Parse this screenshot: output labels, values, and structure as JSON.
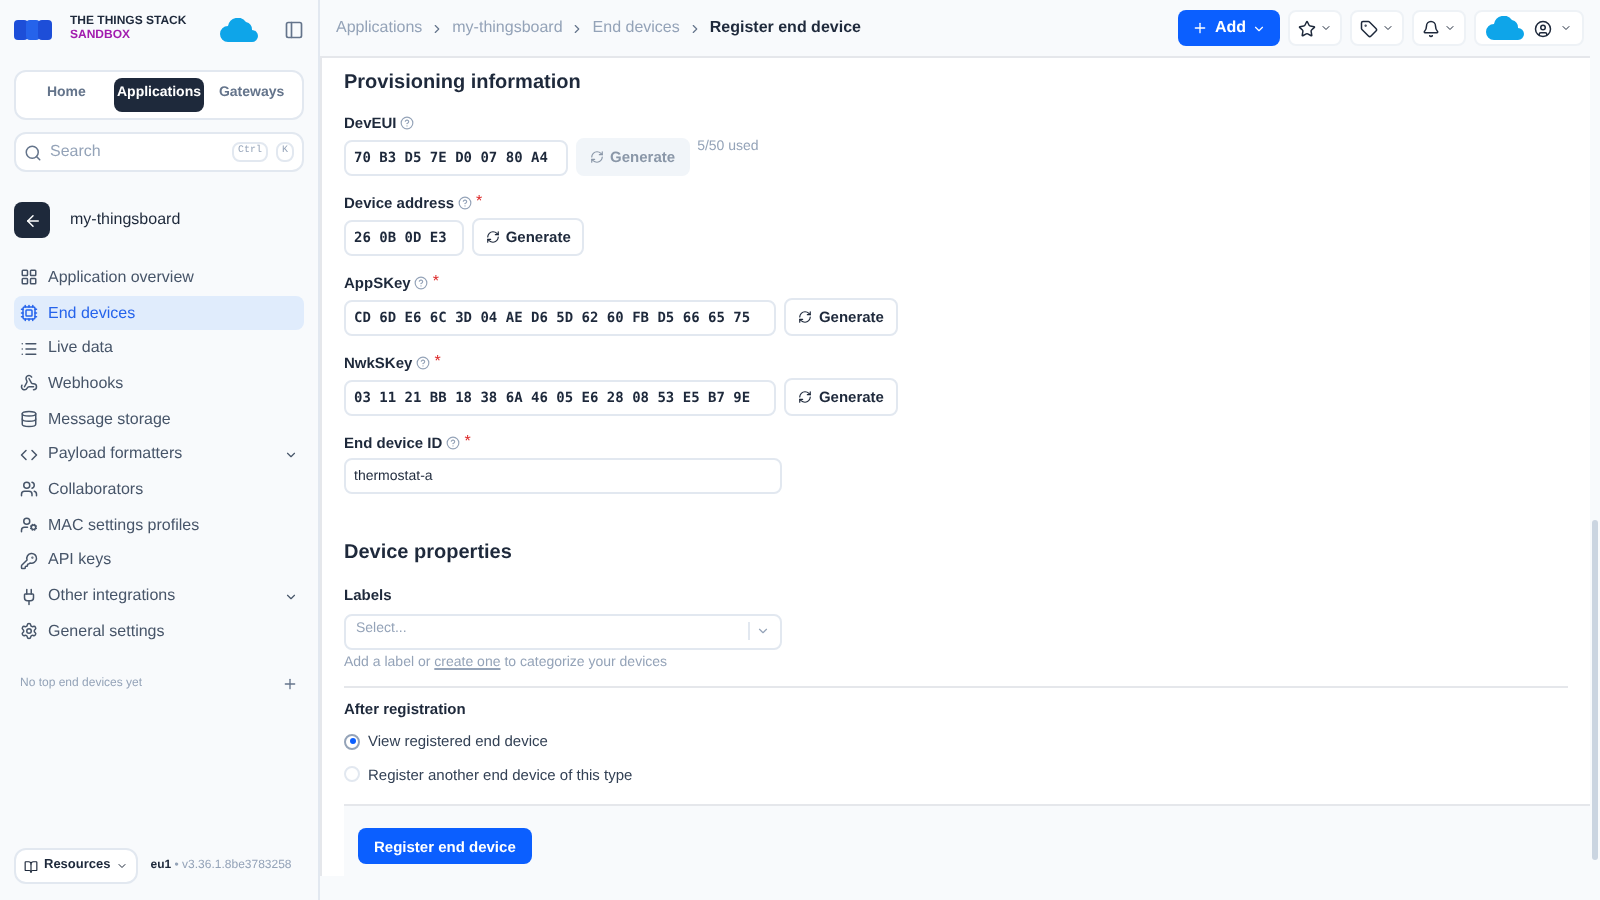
{
  "sidebar": {
    "logo": {
      "line1": "THE THINGS STACK",
      "line2": "SANDBOX"
    },
    "tabs": [
      {
        "label": "Home",
        "selected": false
      },
      {
        "label": "Applications",
        "selected": true
      },
      {
        "label": "Gateways",
        "selected": false
      }
    ],
    "search": {
      "placeholder": "Search",
      "keys": [
        "Ctrl",
        "K"
      ]
    },
    "application": "my-thingsboard",
    "items": [
      {
        "kind": "overview",
        "label": "Application overview",
        "selected": false,
        "expandable": false
      },
      {
        "kind": "devices",
        "label": "End devices",
        "selected": true,
        "expandable": false
      },
      {
        "kind": "live",
        "label": "Live data",
        "selected": false,
        "expandable": false
      },
      {
        "kind": "webhooks",
        "label": "Webhooks",
        "selected": false,
        "expandable": false
      },
      {
        "kind": "storage",
        "label": "Message storage",
        "selected": false,
        "expandable": false
      },
      {
        "kind": "formatters",
        "label": "Payload formatters",
        "selected": false,
        "expandable": true
      },
      {
        "kind": "collaborators",
        "label": "Collaborators",
        "selected": false,
        "expandable": false
      },
      {
        "kind": "mac",
        "label": "MAC settings profiles",
        "selected": false,
        "expandable": false
      },
      {
        "kind": "keys",
        "label": "API keys",
        "selected": false,
        "expandable": false
      },
      {
        "kind": "integrations",
        "label": "Other integrations",
        "selected": false,
        "expandable": true
      },
      {
        "kind": "settings",
        "label": "General settings",
        "selected": false,
        "expandable": false
      }
    ],
    "top_devices_note": "No top end devices yet",
    "resources": "Resources",
    "cluster": "eu1",
    "separator": "•",
    "version": "v3.36.1.8be3783258"
  },
  "breadcrumbs": [
    "Applications",
    "my-thingsboard",
    "End devices",
    "Register end device"
  ],
  "header": {
    "add_button": "Add"
  },
  "provisioning": {
    "title": "Provisioning information",
    "fields": [
      {
        "label": "DevEUI",
        "kind": "hex",
        "value": "70 B3 D5 7E D0 07 80 A4",
        "generate": {
          "label": "Generate",
          "disabled": true
        },
        "note": "5/50 used"
      },
      {
        "label": "Device address",
        "required_mark": "*",
        "kind": "hex",
        "value": "26 0B 0D E3",
        "generate": {
          "label": "Generate",
          "disabled": false
        }
      },
      {
        "label": "AppSKey",
        "required_mark": "*",
        "kind": "hex",
        "value": "CD 6D E6 6C 3D 04 AE D6 5D 62 60 FB D5 66 65 75",
        "generate": {
          "label": "Generate",
          "disabled": false
        }
      },
      {
        "label": "NwkSKey",
        "required_mark": "*",
        "kind": "hex",
        "value": "03 11 21 BB 18 38 6A 46 05 E6 28 08 53 E5 B7 9E",
        "generate": {
          "label": "Generate",
          "disabled": false
        }
      },
      {
        "label": "End device ID",
        "required_mark": "*",
        "kind": "text",
        "value": "thermostat-a"
      }
    ]
  },
  "properties": {
    "title": "Device properties",
    "labels": {
      "label": "Labels",
      "placeholder": "Select...",
      "hint_before": "Add a label or",
      "hint_link": "create one",
      "hint_after": "to categorize your devices"
    }
  },
  "after_registration": {
    "title": "After registration",
    "options": [
      {
        "label": "View registered end device",
        "selected": true
      },
      {
        "label": "Register another end device of this type",
        "selected": false
      }
    ]
  },
  "submit": "Register end device"
}
